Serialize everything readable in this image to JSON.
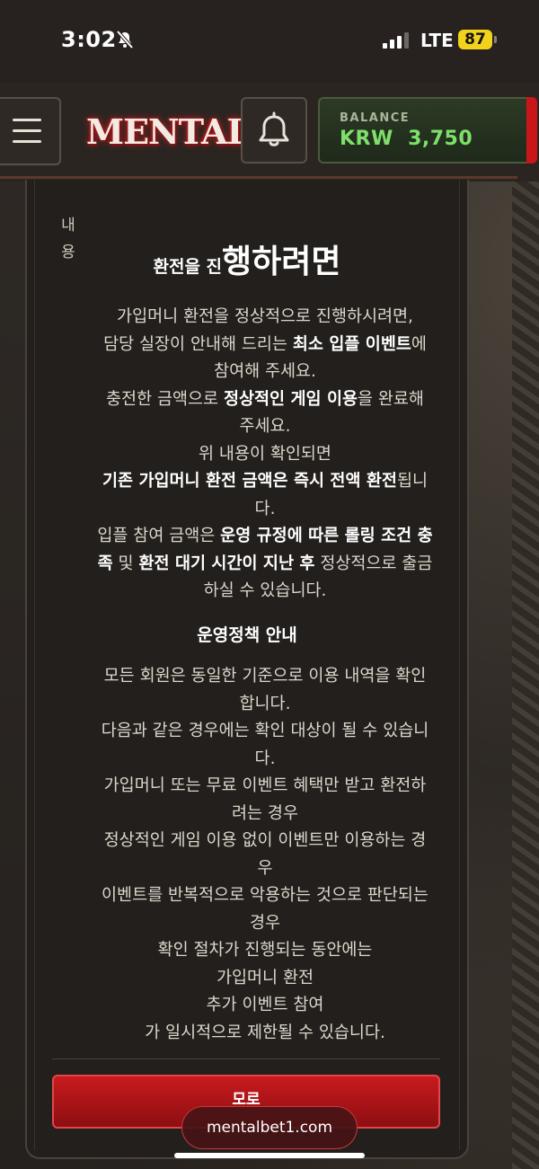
{
  "status_bar": {
    "time": "3:02",
    "network": "LTE",
    "battery": "87"
  },
  "header": {
    "logo_text": "MENTAL",
    "balance_label": "BALANCE",
    "balance_value": "KRW  3,750"
  },
  "modal": {
    "side_label_1": "내",
    "side_label_2": "용",
    "heading_small": "환전을 진",
    "heading_big": "행하려면",
    "paragraphs": [
      [
        "가입머니 환전을 정상적으로 진행하시려면,"
      ],
      [
        "담당 실장이 안내해 드리는 ",
        "최소 입플 이벤트",
        "에"
      ],
      [
        "참여해 주세요."
      ],
      [
        "충전한 금액으로 ",
        "정상적인 게임 이용",
        "을 완료해"
      ],
      [
        "주세요."
      ],
      [
        "위 내용이 확인되면"
      ],
      [
        "기존 가입머니 환전 금액은 즉시 전액 환전",
        "됩니"
      ],
      [
        "다."
      ],
      [
        "입플 참여 금액은 ",
        "운영 규정에 따른 롤링 조건 충"
      ],
      [
        "족",
        " 및 ",
        "환전 대기 시간이 지난 후",
        " 정상적으로 출금"
      ],
      [
        "하실 수 있습니다."
      ]
    ],
    "policy_title": "운영정책 안내",
    "policy_lines": [
      "모든 회원은 동일한 기준으로 이용 내역을 확인",
      "합니다.",
      "다음과 같은 경우에는 확인 대상이 될 수 있습니",
      "다.",
      "가입머니 또는 무료 이벤트 혜택만 받고 환전하",
      "려는 경우",
      "정상적인 게임 이용 없이 이벤트만 이용하는 경",
      "우",
      "이벤트를 반복적으로 악용하는 것으로 판단되는",
      "경우",
      "확인 절차가 진행되는 동안에는",
      "가입머니 환전",
      "추가 이벤트 참여",
      "가 일시적으로 제한될 수 있습니다."
    ],
    "close_label": "모로"
  },
  "browser": {
    "url": "mentalbet1.com"
  },
  "colors": {
    "accent_red": "#c91a1e",
    "balance_green": "#7ee06a",
    "card_bg": "#221f1c"
  }
}
